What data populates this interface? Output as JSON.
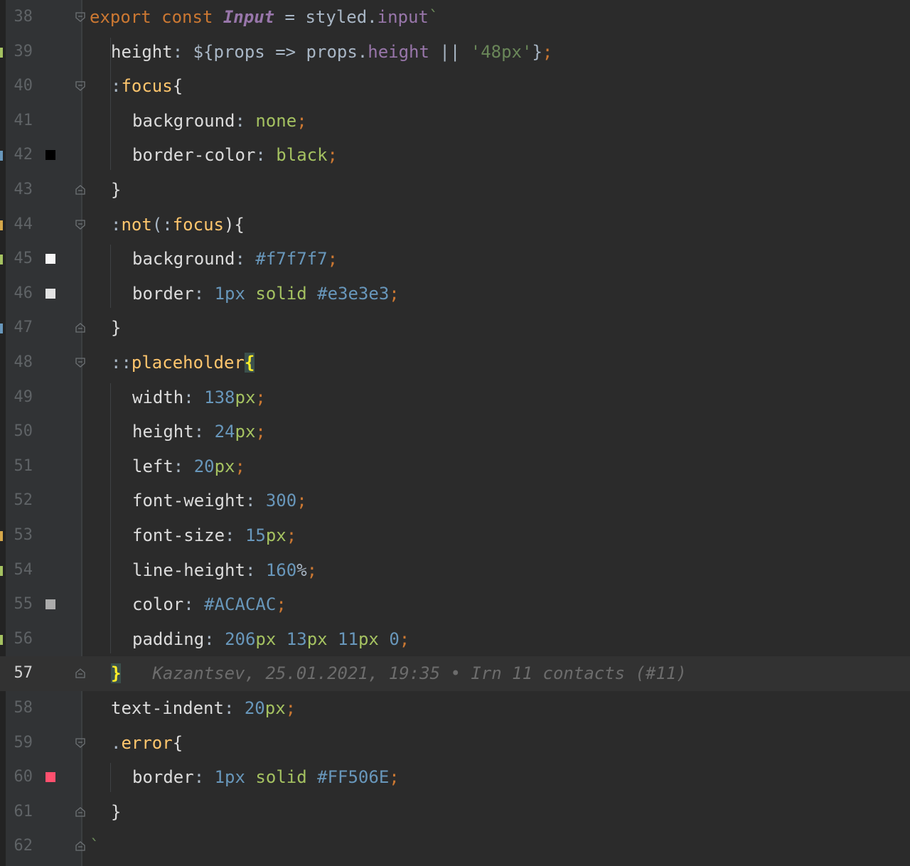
{
  "editor": {
    "blame": "Kazantsev, 25.01.2021, 19:35 • Irn 11 contacts (#11)",
    "lines": [
      {
        "n": "38",
        "indent": 0,
        "fold": "open",
        "tokens": [
          [
            "export ",
            "kw"
          ],
          [
            "const ",
            "kw"
          ],
          [
            "Input",
            "ital"
          ],
          [
            " = ",
            "default"
          ],
          [
            "styled.",
            "default"
          ],
          [
            "input",
            "purple"
          ],
          [
            "`",
            "str"
          ]
        ]
      },
      {
        "n": "39",
        "indent": 1,
        "tokens": [
          [
            "height",
            "prop"
          ],
          [
            ": ${",
            "default"
          ],
          [
            "props => props.",
            "default"
          ],
          [
            "height",
            "purple"
          ],
          [
            " || ",
            "default"
          ],
          [
            "'48px'",
            "str"
          ],
          [
            "}",
            "default"
          ],
          [
            ";",
            "semi"
          ]
        ]
      },
      {
        "n": "40",
        "indent": 1,
        "fold": "open",
        "tokens": [
          [
            ":",
            "default"
          ],
          [
            "focus",
            "sel"
          ],
          [
            "{",
            "brace"
          ]
        ]
      },
      {
        "n": "41",
        "indent": 2,
        "tokens": [
          [
            "background",
            "prop"
          ],
          [
            ": ",
            "default"
          ],
          [
            "none",
            "val"
          ],
          [
            ";",
            "semi"
          ]
        ]
      },
      {
        "n": "42",
        "indent": 2,
        "swatch": "#000000",
        "tokens": [
          [
            "border-color",
            "prop"
          ],
          [
            ": ",
            "default"
          ],
          [
            "black",
            "val"
          ],
          [
            ";",
            "semi"
          ]
        ]
      },
      {
        "n": "43",
        "indent": 1,
        "fold": "close",
        "tokens": [
          [
            "}",
            "brace"
          ]
        ]
      },
      {
        "n": "44",
        "indent": 1,
        "fold": "open",
        "tokens": [
          [
            ":",
            "default"
          ],
          [
            "not",
            "sel"
          ],
          [
            "(:",
            "default"
          ],
          [
            "focus",
            "sel"
          ],
          [
            "){",
            "brace"
          ]
        ]
      },
      {
        "n": "45",
        "indent": 2,
        "swatch": "#f7f7f7",
        "tokens": [
          [
            "background",
            "prop"
          ],
          [
            ": ",
            "default"
          ],
          [
            "#f7f7f7",
            "num"
          ],
          [
            ";",
            "semi"
          ]
        ]
      },
      {
        "n": "46",
        "indent": 2,
        "swatch": "#e3e3e3",
        "tokens": [
          [
            "border",
            "prop"
          ],
          [
            ": ",
            "default"
          ],
          [
            "1px",
            "num"
          ],
          [
            " ",
            "default"
          ],
          [
            "solid",
            "val"
          ],
          [
            " ",
            "default"
          ],
          [
            "#e3e3e3",
            "num"
          ],
          [
            ";",
            "semi"
          ]
        ]
      },
      {
        "n": "47",
        "indent": 1,
        "fold": "close",
        "tokens": [
          [
            "}",
            "brace"
          ]
        ]
      },
      {
        "n": "48",
        "indent": 1,
        "fold": "open",
        "tokens": [
          [
            "::",
            "default"
          ],
          [
            "placeholder",
            "sel"
          ],
          [
            "{",
            "brace-hl"
          ]
        ]
      },
      {
        "n": "49",
        "indent": 2,
        "tokens": [
          [
            "width",
            "prop"
          ],
          [
            ": ",
            "default"
          ],
          [
            "138",
            "num"
          ],
          [
            "px",
            "val"
          ],
          [
            ";",
            "semi"
          ]
        ]
      },
      {
        "n": "50",
        "indent": 2,
        "tokens": [
          [
            "height",
            "prop"
          ],
          [
            ": ",
            "default"
          ],
          [
            "24",
            "num"
          ],
          [
            "px",
            "val"
          ],
          [
            ";",
            "semi"
          ]
        ]
      },
      {
        "n": "51",
        "indent": 2,
        "tokens": [
          [
            "left",
            "prop"
          ],
          [
            ": ",
            "default"
          ],
          [
            "20",
            "num"
          ],
          [
            "px",
            "val"
          ],
          [
            ";",
            "semi"
          ]
        ]
      },
      {
        "n": "52",
        "indent": 2,
        "tokens": [
          [
            "font-weight",
            "prop"
          ],
          [
            ": ",
            "default"
          ],
          [
            "300",
            "num"
          ],
          [
            ";",
            "semi"
          ]
        ]
      },
      {
        "n": "53",
        "indent": 2,
        "tokens": [
          [
            "font-size",
            "prop"
          ],
          [
            ": ",
            "default"
          ],
          [
            "15",
            "num"
          ],
          [
            "px",
            "val"
          ],
          [
            ";",
            "semi"
          ]
        ]
      },
      {
        "n": "54",
        "indent": 2,
        "tokens": [
          [
            "line-height",
            "prop"
          ],
          [
            ": ",
            "default"
          ],
          [
            "160",
            "num"
          ],
          [
            "%",
            "default"
          ],
          [
            ";",
            "semi"
          ]
        ]
      },
      {
        "n": "55",
        "indent": 2,
        "swatch": "#acacac",
        "tokens": [
          [
            "color",
            "prop"
          ],
          [
            ": ",
            "default"
          ],
          [
            "#ACACAC",
            "num"
          ],
          [
            ";",
            "semi"
          ]
        ]
      },
      {
        "n": "56",
        "indent": 2,
        "tokens": [
          [
            "padding",
            "prop"
          ],
          [
            ": ",
            "default"
          ],
          [
            "206",
            "num"
          ],
          [
            "px",
            "val"
          ],
          [
            " ",
            "default"
          ],
          [
            "13",
            "num"
          ],
          [
            "px",
            "val"
          ],
          [
            " ",
            "default"
          ],
          [
            "11",
            "num"
          ],
          [
            "px",
            "val"
          ],
          [
            " ",
            "default"
          ],
          [
            "0",
            "num"
          ],
          [
            ";",
            "semi"
          ]
        ]
      },
      {
        "n": "57",
        "indent": 1,
        "fold": "close",
        "current": true,
        "blame": true,
        "tokens": [
          [
            "}",
            "brace-hl"
          ]
        ]
      },
      {
        "n": "58",
        "indent": 1,
        "tokens": [
          [
            "text-indent",
            "prop"
          ],
          [
            ": ",
            "default"
          ],
          [
            "20",
            "num"
          ],
          [
            "px",
            "val"
          ],
          [
            ";",
            "semi"
          ]
        ]
      },
      {
        "n": "59",
        "indent": 1,
        "fold": "open",
        "tokens": [
          [
            ".",
            "default"
          ],
          [
            "error",
            "sel"
          ],
          [
            "{",
            "brace"
          ]
        ]
      },
      {
        "n": "60",
        "indent": 2,
        "swatch": "#ff506e",
        "tokens": [
          [
            "border",
            "prop"
          ],
          [
            ": ",
            "default"
          ],
          [
            "1px",
            "num"
          ],
          [
            " ",
            "default"
          ],
          [
            "solid",
            "val"
          ],
          [
            " ",
            "default"
          ],
          [
            "#FF506E",
            "num"
          ],
          [
            ";",
            "semi"
          ]
        ]
      },
      {
        "n": "61",
        "indent": 1,
        "fold": "close",
        "tokens": [
          [
            "}",
            "brace"
          ]
        ]
      },
      {
        "n": "62",
        "indent": 0,
        "fold": "close",
        "tokens": [
          [
            "`",
            "str"
          ]
        ]
      }
    ]
  }
}
